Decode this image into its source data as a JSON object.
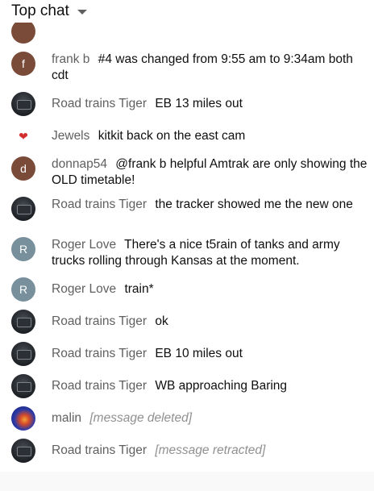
{
  "header": {
    "title": "Top chat"
  },
  "messages": [
    {
      "author": "frank b",
      "text": "#4 was changed from 9:55 am to 9:34am both cdt",
      "avatar_initial": "f"
    },
    {
      "author": "Road trains Tiger",
      "text": "EB 13 miles out"
    },
    {
      "author": "Jewels",
      "text": "kitkit back on the east cam"
    },
    {
      "author": "donnap54",
      "text": "@frank b helpful Amtrak are only showing the OLD timetable!",
      "avatar_initial": "d"
    },
    {
      "author": "Road trains Tiger",
      "text": "the tracker showed me the new one"
    },
    {
      "author": "Roger Love",
      "text": "There's a nice t5rain of tanks and army trucks rolling through Kansas at the moment.",
      "avatar_initial": "R"
    },
    {
      "author": "Roger Love",
      "text": "train*",
      "avatar_initial": "R"
    },
    {
      "author": "Road trains Tiger",
      "text": "ok"
    },
    {
      "author": "Road trains Tiger",
      "text": "EB 10 miles out"
    },
    {
      "author": "Road trains Tiger",
      "text": "WB approaching Baring"
    },
    {
      "author": "malin",
      "text": "[message deleted]"
    },
    {
      "author": "Road trains Tiger",
      "text": "[message retracted]"
    }
  ],
  "colors": {
    "author": "#606060",
    "deleted": "#909090",
    "roger_avatar": "#78909c",
    "f_avatar": "#7b4b3a"
  }
}
